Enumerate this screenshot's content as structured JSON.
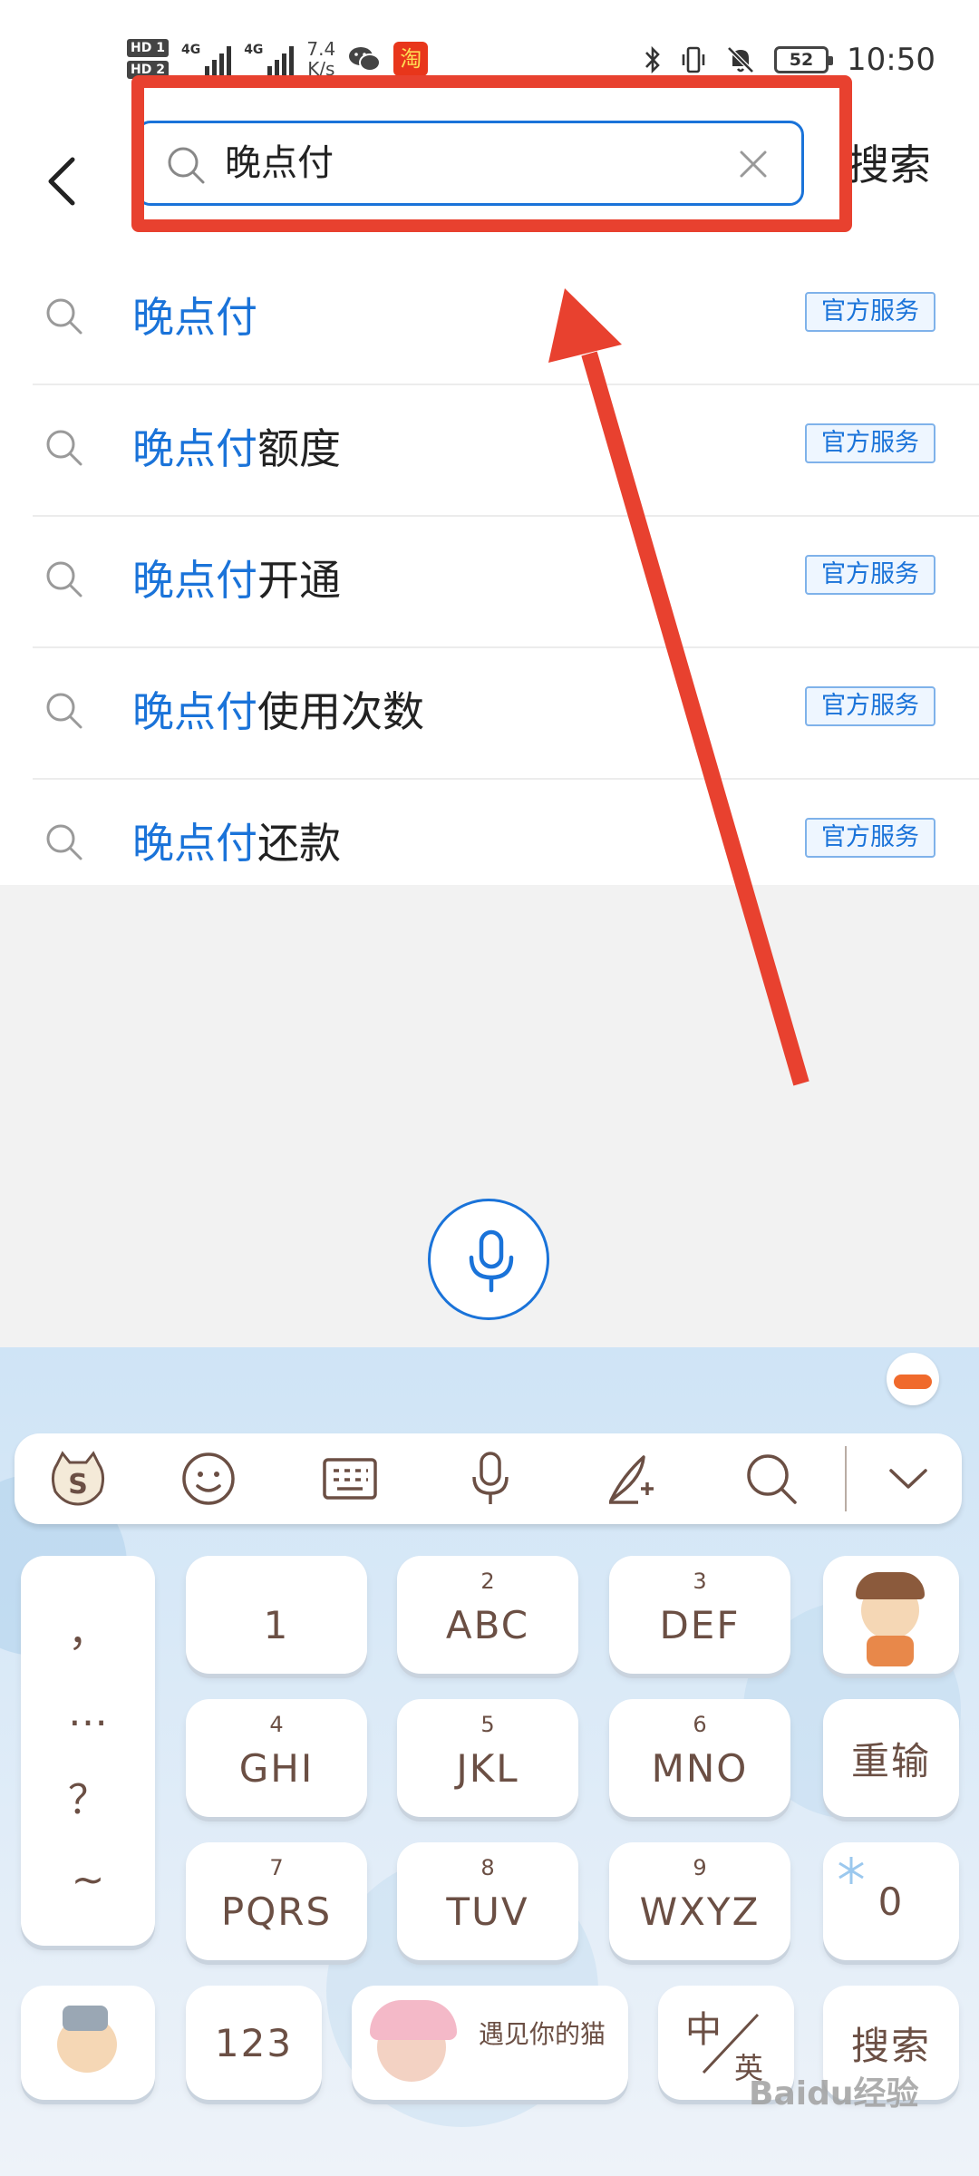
{
  "status_bar": {
    "hd_badges": [
      "HD 1",
      "HD 2"
    ],
    "network_labels": [
      "4G",
      "4G"
    ],
    "speed_value": "7.4",
    "speed_unit": "K/s",
    "battery": "52",
    "time": "10:50"
  },
  "search": {
    "query": "晚点付",
    "submit_label": "搜索"
  },
  "suggestions": [
    {
      "highlight": "晚点付",
      "rest": "",
      "badge": "官方服务"
    },
    {
      "highlight": "晚点付",
      "rest": "额度",
      "badge": "官方服务"
    },
    {
      "highlight": "晚点付",
      "rest": "开通",
      "badge": "官方服务"
    },
    {
      "highlight": "晚点付",
      "rest": "使用次数",
      "badge": "官方服务"
    },
    {
      "highlight": "晚点付",
      "rest": "还款",
      "badge": "官方服务"
    }
  ],
  "keyboard": {
    "punctuation": [
      "，",
      "…",
      "？",
      "~"
    ],
    "keys": [
      {
        "num": "",
        "label": "1"
      },
      {
        "num": "2",
        "label": "ABC"
      },
      {
        "num": "3",
        "label": "DEF"
      },
      {
        "num": "4",
        "label": "GHI"
      },
      {
        "num": "5",
        "label": "JKL"
      },
      {
        "num": "6",
        "label": "MNO"
      },
      {
        "num": "7",
        "label": "PQRS"
      },
      {
        "num": "8",
        "label": "TUV"
      },
      {
        "num": "9",
        "label": "WXYZ"
      }
    ],
    "reenter_label": "重输",
    "zero_label": "0",
    "numbers_label": "123",
    "space_caption": "遇见你的猫",
    "lang_zh": "中",
    "lang_en": "英",
    "search_label": "搜索"
  },
  "watermark": "Baidu经验",
  "colors": {
    "accent": "#1a73d9",
    "annotation_red": "#e8412f",
    "key_text": "#6b4f44"
  }
}
